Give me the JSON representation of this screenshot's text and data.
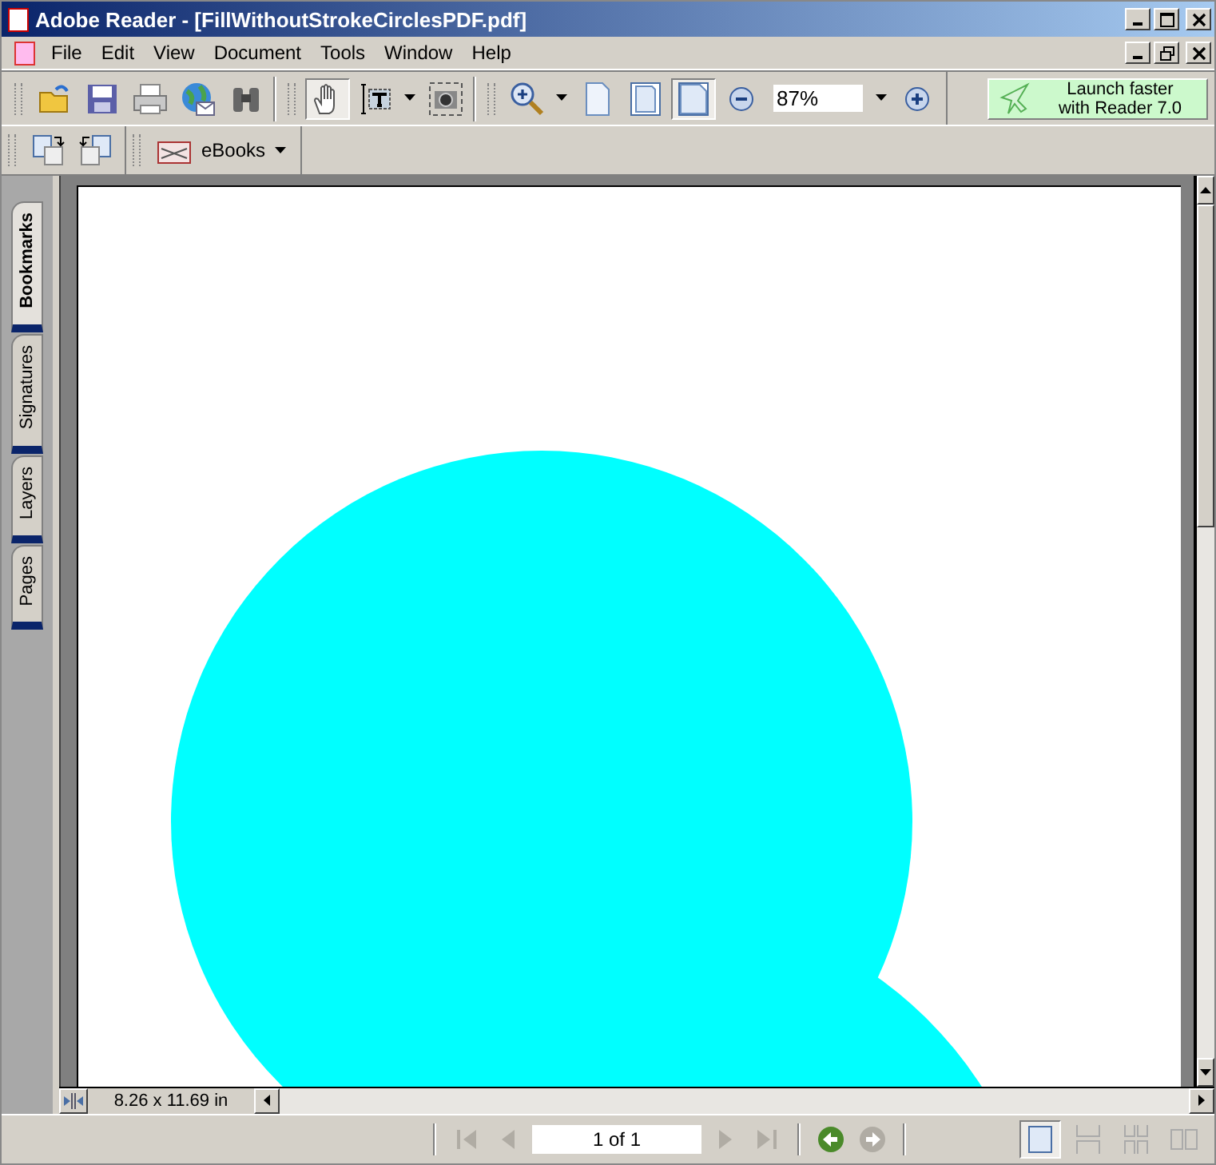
{
  "window": {
    "title": "Adobe Reader - [FillWithoutStrokeCirclesPDF.pdf]"
  },
  "menu": [
    "File",
    "Edit",
    "View",
    "Document",
    "Tools",
    "Window",
    "Help"
  ],
  "toolbar": [
    {
      "kind": "open",
      "selected": false
    },
    {
      "kind": "save",
      "selected": false
    },
    {
      "kind": "print",
      "selected": false
    },
    {
      "kind": "email",
      "selected": false
    },
    {
      "kind": "search",
      "selected": false
    },
    {
      "kind": "sep"
    },
    {
      "kind": "hand",
      "selected": true
    },
    {
      "kind": "text-select",
      "selected": false
    },
    {
      "kind": "dropdown"
    },
    {
      "kind": "snapshot",
      "selected": false
    },
    {
      "kind": "sep"
    },
    {
      "kind": "zoom-in",
      "selected": false
    },
    {
      "kind": "dropdown"
    },
    {
      "kind": "actual-size",
      "selected": false
    },
    {
      "kind": "fit-page",
      "selected": false
    },
    {
      "kind": "fit-width",
      "selected": true
    },
    {
      "kind": "zoom-minus",
      "selected": false
    },
    {
      "kind": "zoom-field",
      "value": "87%"
    },
    {
      "kind": "dropdown"
    },
    {
      "kind": "zoom-plus",
      "selected": false
    }
  ],
  "promo": {
    "text": "Launch faster\nwith Reader 7.0"
  },
  "toolbar2": {
    "ebooks": "eBooks"
  },
  "side_tabs": [
    {
      "label": "Bookmarks",
      "selected": true
    },
    {
      "label": "Signatures",
      "selected": false
    },
    {
      "label": "Layers",
      "selected": false
    },
    {
      "label": "Pages",
      "selected": false
    }
  ],
  "page_size": "8.26 x 11.69 in",
  "navigation": [
    {
      "kind": "first",
      "disabled": true
    },
    {
      "kind": "prev",
      "disabled": true
    },
    {
      "kind": "page-field",
      "value": "1 of 1"
    },
    {
      "kind": "next",
      "disabled": true
    },
    {
      "kind": "last",
      "disabled": true
    },
    {
      "kind": "sep"
    },
    {
      "kind": "back",
      "disabled": false
    },
    {
      "kind": "forward",
      "disabled": true
    }
  ],
  "view_modes": [
    {
      "kind": "single",
      "selected": true
    },
    {
      "kind": "continuous",
      "selected": false
    },
    {
      "kind": "continuous-facing",
      "selected": false
    },
    {
      "kind": "facing",
      "selected": false
    }
  ]
}
